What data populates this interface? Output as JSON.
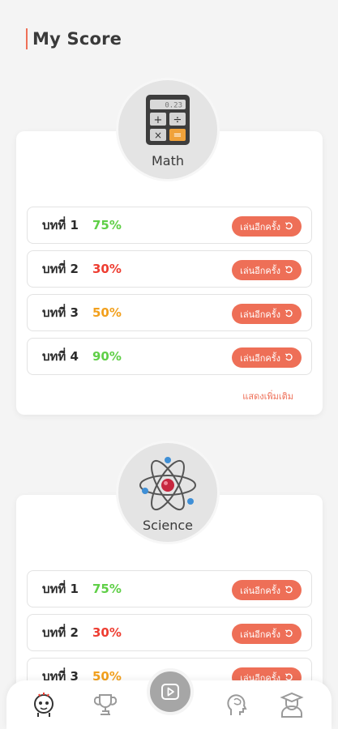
{
  "header": {
    "title": "My Score"
  },
  "subjects": [
    {
      "name": "Math",
      "icon": "calculator-icon",
      "lessons": [
        {
          "label": "บทที่ 1",
          "score": "75%",
          "color": "#5fcf47"
        },
        {
          "label": "บทที่ 2",
          "score": "30%",
          "color": "#ee3d31"
        },
        {
          "label": "บทที่ 3",
          "score": "50%",
          "color": "#f2a01d"
        },
        {
          "label": "บทที่ 4",
          "score": "90%",
          "color": "#5fcf47"
        }
      ],
      "show_more": "แสดงเพิ่มเติม"
    },
    {
      "name": "Science",
      "icon": "atom-icon",
      "lessons": [
        {
          "label": "บทที่ 1",
          "score": "75%",
          "color": "#5fcf47"
        },
        {
          "label": "บทที่ 2",
          "score": "30%",
          "color": "#ee3d31"
        },
        {
          "label": "บทที่ 3",
          "score": "50%",
          "color": "#f2a01d"
        }
      ]
    }
  ],
  "replay_label": "เล่นอีกครั้ง",
  "nav": {
    "items": [
      {
        "name": "home",
        "icon": "mascot-icon",
        "active": true
      },
      {
        "name": "trophy",
        "icon": "trophy-icon",
        "active": false
      },
      {
        "name": "play",
        "icon": "play-icon",
        "active": false
      },
      {
        "name": "brain",
        "icon": "brain-icon",
        "active": false
      },
      {
        "name": "profile",
        "icon": "graduate-icon",
        "active": false
      }
    ]
  },
  "colors": {
    "accent": "#ee6f57",
    "background": "#f4f4f4"
  }
}
